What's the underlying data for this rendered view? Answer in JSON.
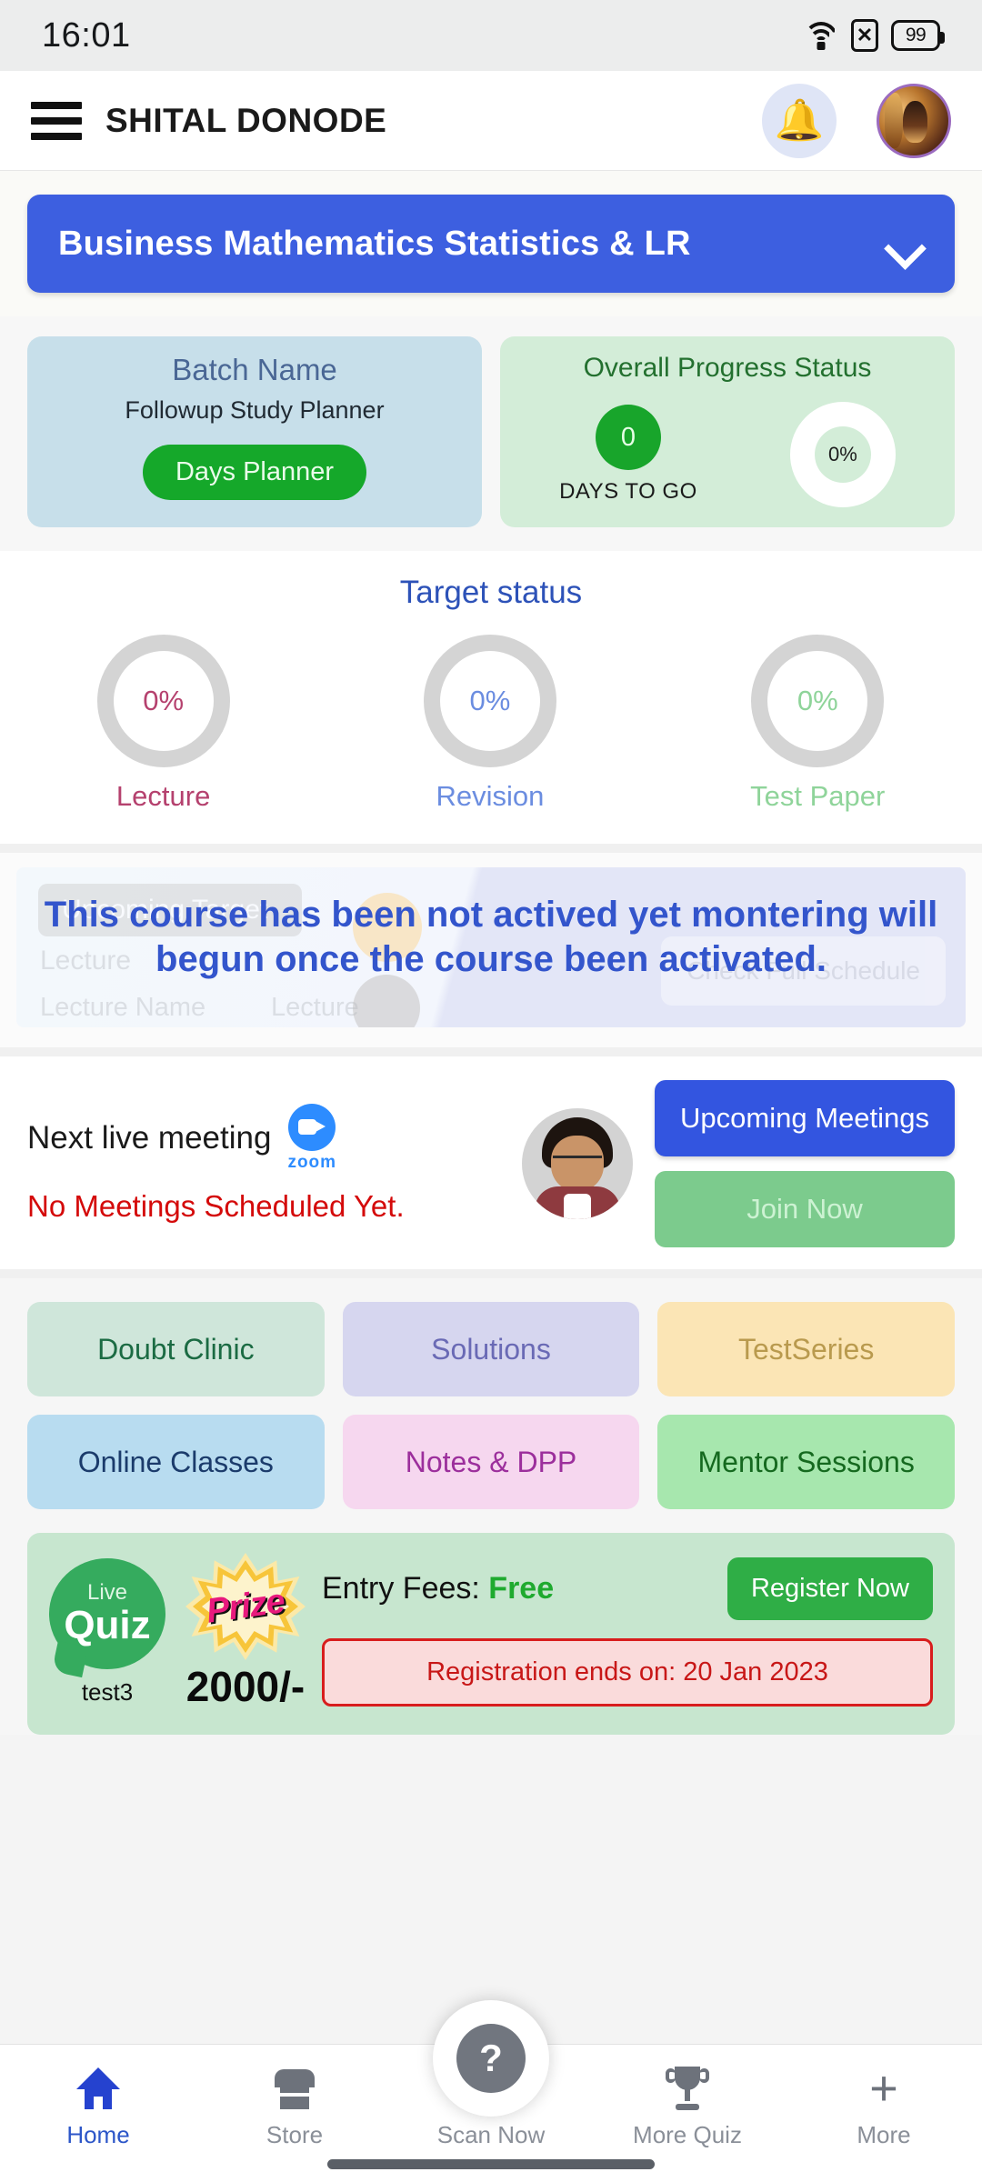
{
  "status_bar": {
    "time": "16:01",
    "battery_level": "99",
    "icons": [
      "wifi-icon",
      "no-sim-icon",
      "battery-icon"
    ]
  },
  "app_bar": {
    "menu_icon": "hamburger-menu-icon",
    "title": "SHITAL DONODE",
    "bell_icon": "notification-bell-icon",
    "avatar": "user-avatar"
  },
  "course_selector": {
    "label": "Business Mathematics Statistics & LR",
    "chevron": "chevron-down-icon",
    "accent": "#3d5fe0"
  },
  "batch_card": {
    "title": "Batch Name",
    "name": "Followup Study Planner",
    "button": "Days Planner",
    "bg": "#c7dfea",
    "button_color": "#15a82a"
  },
  "progress_card": {
    "title": "Overall Progress Status",
    "days_value": "0",
    "days_label": "DAYS TO GO",
    "percent": "0%",
    "bg": "#d3edd8"
  },
  "target_status": {
    "title": "Target status",
    "items": [
      {
        "label": "Lecture",
        "percent": "0%",
        "color": "#b5416e"
      },
      {
        "label": "Revision",
        "percent": "0%",
        "color": "#6b8de0"
      },
      {
        "label": "Test Paper",
        "percent": "0%",
        "color": "#8fd49a"
      }
    ]
  },
  "upcoming_target": {
    "ghost_tag": "Upcoming Target",
    "ghost_lecture": "Lecture",
    "ghost_lecture_name": "Lecture Name",
    "ghost_lecture_2": "Lecture",
    "ghost_schedule": "Check Full Schedule",
    "overlay_message": "This course has been not actived yet montering will begun once the course been activated.",
    "overlay_color": "#3355cc"
  },
  "live_meeting": {
    "title": "Next live meeting",
    "provider": "zoom",
    "status": "No Meetings Scheduled Yet.",
    "status_color": "#d40a0a",
    "upcoming_button": "Upcoming Meetings",
    "join_button": "Join Now"
  },
  "tiles": [
    {
      "label": "Doubt Clinic",
      "bg": "#cfe6da",
      "color": "#1b6b43"
    },
    {
      "label": "Solutions",
      "bg": "#d6d6ef",
      "color": "#6a6ab5"
    },
    {
      "label": "TestSeries",
      "bg": "#fbe5b5",
      "color": "#b99a4e"
    },
    {
      "label": "Online Classes",
      "bg": "#b8dcf0",
      "color": "#1b3b6b"
    },
    {
      "label": "Notes & DPP",
      "bg": "#f6d7ef",
      "color": "#9c2f9c"
    },
    {
      "label": "Mentor Sessions",
      "bg": "#a7e7ae",
      "color": "#15691f"
    }
  ],
  "quiz_banner": {
    "live_label": "Live",
    "quiz_label": "Quiz",
    "quiz_name": "test3",
    "prize_label": "Prize",
    "prize_amount": "2000/-",
    "entry_label": "Entry Fees:",
    "entry_value": "Free",
    "register_button": "Register Now",
    "registration_ends": "Registration ends on: 20 Jan 2023",
    "bg": "#c7e6cf"
  },
  "bottom_nav": {
    "items": [
      {
        "label": "Home",
        "icon": "home-icon",
        "active": true
      },
      {
        "label": "Store",
        "icon": "store-icon",
        "active": false
      },
      {
        "label": "Scan Now",
        "icon": "scan-icon",
        "active": false
      },
      {
        "label": "More Quiz",
        "icon": "trophy-icon",
        "active": false
      },
      {
        "label": "More",
        "icon": "plus-icon",
        "active": false
      }
    ],
    "fab_glyph": "?"
  }
}
